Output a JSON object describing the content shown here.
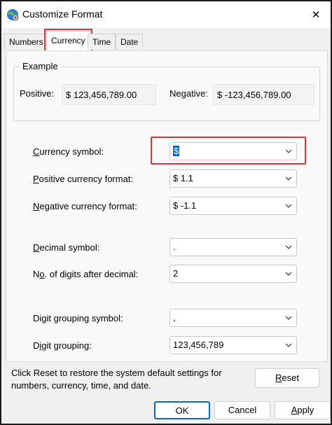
{
  "window": {
    "title": "Customize Format",
    "app_icon": "settings-globe-icon",
    "close_glyph": "✕"
  },
  "tabs": [
    {
      "label": "Numbers",
      "active": false
    },
    {
      "label": "Currency",
      "active": true
    },
    {
      "label": "Time",
      "active": false
    },
    {
      "label": "Date",
      "active": false
    }
  ],
  "example": {
    "legend": "Example",
    "positive_label": "Positive:",
    "positive_value": "$ 123,456,789.00",
    "negative_label": "Negative:",
    "negative_value": "$ -123,456,789.00"
  },
  "settings": {
    "currency_symbol": {
      "label_before": "",
      "label_u": "C",
      "label_after": "urrency symbol:",
      "value": "$"
    },
    "positive_format": {
      "label_before": "",
      "label_u": "P",
      "label_after": "ositive currency format:",
      "value": "$ 1.1"
    },
    "negative_format": {
      "label_before": "",
      "label_u": "N",
      "label_after": "egative currency format:",
      "value": "$ -1.1"
    },
    "decimal_symbol": {
      "label_before": "",
      "label_u": "D",
      "label_after": "ecimal symbol:",
      "value": "."
    },
    "digits_after_decimal": {
      "label_before": "N",
      "label_u": "o",
      "label_after": ". of digits after decimal:",
      "value": "2"
    },
    "grouping_symbol": {
      "label_before": "Di",
      "label_u": "g",
      "label_after": "it grouping symbol:",
      "value": ","
    },
    "grouping": {
      "label_before": "D",
      "label_u": "i",
      "label_after": "git grouping:",
      "value": "123,456,789"
    }
  },
  "footer": {
    "reset_note": "Click Reset to restore the system default settings for numbers, currency, time, and date.",
    "reset_label_u": "R",
    "reset_label_after": "eset"
  },
  "buttons": {
    "ok": "OK",
    "cancel": "Cancel",
    "apply_u": "A",
    "apply_after": "pply"
  },
  "colors": {
    "highlight": "#d23a3a",
    "accent": "#0a64c8"
  }
}
